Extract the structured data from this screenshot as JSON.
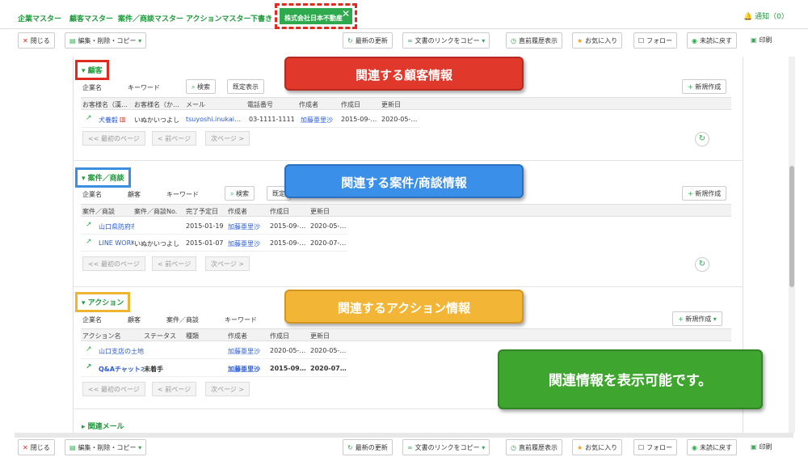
{
  "tabs": {
    "items": [
      "企業マスター",
      "顧客マスター",
      "案件／商談マスター",
      "アクションマスター",
      "下書き"
    ],
    "active": "株式会社日本不動産",
    "notice": "通知（0）"
  },
  "toolbar": {
    "close": "閉じる",
    "edit": "編集・削除・コピー",
    "refresh": "最新の更新",
    "copy_link": "文書のリンクをコピー",
    "history": "直前履歴表示",
    "favorite": "お気に入り",
    "follow": "フォロー",
    "unread": "未読に戻す",
    "print": "印刷"
  },
  "customer": {
    "title": "顧客",
    "filter_company": "企業名",
    "filter_keyword": "キーワード",
    "search": "検索",
    "default_view": "既定表示",
    "new": "新規作成",
    "headers": [
      "お客様名（漢…",
      "お客様名（か…",
      "メール",
      "電話番号",
      "作成者",
      "作成日",
      "更新日"
    ],
    "rows": [
      [
        "犬養毅",
        "いぬかいつよし",
        "tsuyoshi.inukai…",
        "03-1111-1111",
        "加藤亜里沙",
        "2015-09-…",
        "2020-05-…"
      ]
    ]
  },
  "deal": {
    "title": "案件／商談",
    "filter_company": "企業名",
    "filter_customer": "顧客",
    "filter_keyword": "キーワード",
    "search": "検索",
    "default_view": "既定",
    "new": "新規作成",
    "headers": [
      "案件／商談",
      "案件／商談No.",
      "完了予定日",
      "作成者",
      "作成日",
      "更新日"
    ],
    "rows": [
      [
        "山口県防府市",
        "",
        "2015-01-19",
        "加藤亜里沙",
        "2015-09-…",
        "2020-05-…"
      ],
      [
        "LINE WORK",
        "いぬかいつよし",
        "2015-01-07",
        "加藤亜里沙",
        "2015-09-…",
        "2020-07-…"
      ]
    ]
  },
  "action": {
    "title": "アクション",
    "filter_company": "企業名",
    "filter_customer": "顧客",
    "filter_deal": "案件／商談",
    "filter_keyword": "キーワード",
    "new": "新規作成",
    "headers": [
      "アクション名",
      "ステータス",
      "種類",
      "作成者",
      "作成日",
      "更新日"
    ],
    "rows": [
      [
        "山口支店の土地",
        "",
        "",
        "加藤亜里沙",
        "2020-05-…",
        "2020-05-…"
      ],
      [
        "Q&Aチャットオ",
        "未着手",
        "",
        "加藤亜里沙",
        "2015-09…",
        "2020-07…"
      ]
    ]
  },
  "pager": {
    "first": "<< 最初のページ",
    "prev": "< 前ページ",
    "next": "次ページ >"
  },
  "related_mail": "関連メール",
  "callouts": {
    "customer": "関連する顧客情報",
    "deal": "関連する案件/商談情報",
    "action": "関連するアクション情報",
    "summary": "関連情報を表示可能です。"
  },
  "colors": {
    "brand_green": "#2fa94e",
    "callout_red": "#e0382a",
    "callout_blue": "#3a8fe8",
    "callout_yellow": "#f2b535",
    "callout_green": "#3ea52e"
  }
}
